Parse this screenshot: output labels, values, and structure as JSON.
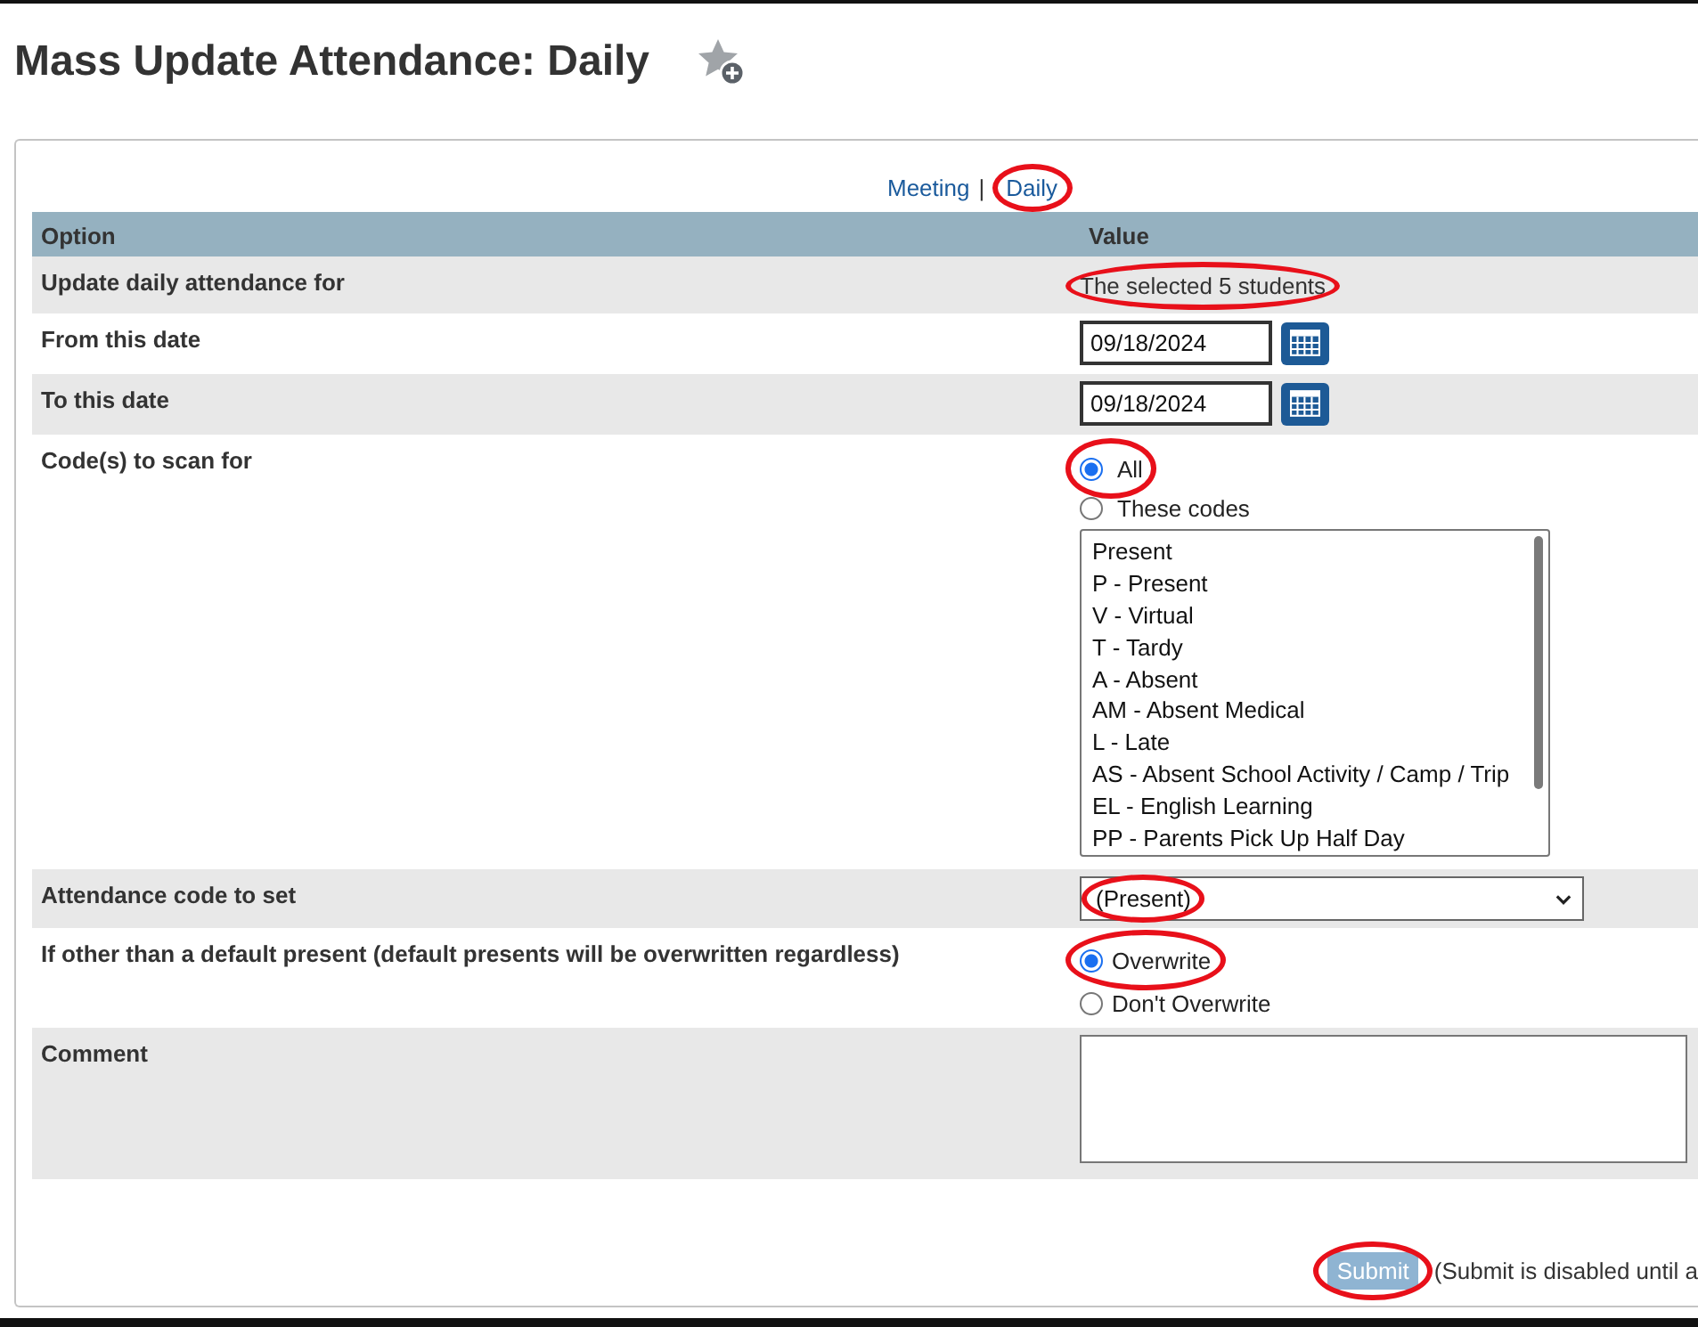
{
  "page_title": "Mass Update Attendance: Daily",
  "mode_links": [
    {
      "label": "Meeting",
      "circled": false
    },
    {
      "label": "Daily",
      "circled": true
    }
  ],
  "mode_separator": "|",
  "table": {
    "columns": [
      "Option",
      "Value"
    ],
    "rows": [
      {
        "kind": "text",
        "label": "Update daily attendance for",
        "value": "The selected 5 students",
        "circled": true
      },
      {
        "kind": "date",
        "label": "From this date",
        "value": "09/18/2024"
      },
      {
        "kind": "date",
        "label": "To this date",
        "value": "09/18/2024"
      },
      {
        "kind": "codes",
        "label": "Code(s) to scan for",
        "options": [
          {
            "label": "All",
            "selected": true,
            "circled": true
          },
          {
            "label": "These codes",
            "selected": false,
            "circled": false
          }
        ],
        "codes": [
          "Present",
          "P - Present",
          "V - Virtual",
          "T - Tardy",
          "A - Absent",
          "AM - Absent Medical",
          "L - Late",
          "AS - Absent School Activity / Camp / Trip",
          "EL - English Learning",
          "PP - Parents Pick Up Half Day"
        ]
      },
      {
        "kind": "select",
        "label": "Attendance code to set",
        "value": "(Present)",
        "circled": true
      },
      {
        "kind": "radio",
        "label": "If other than a default present (default presents will be overwritten regardless)",
        "options": [
          {
            "label": "Overwrite",
            "selected": true,
            "circled": true
          },
          {
            "label": "Don't Overwrite",
            "selected": false,
            "circled": false
          }
        ]
      },
      {
        "kind": "textarea",
        "label": "Comment"
      }
    ]
  },
  "submit": {
    "label": "Submit",
    "disabled": true,
    "circled": true,
    "note": "(Submit is disabled until a"
  }
}
